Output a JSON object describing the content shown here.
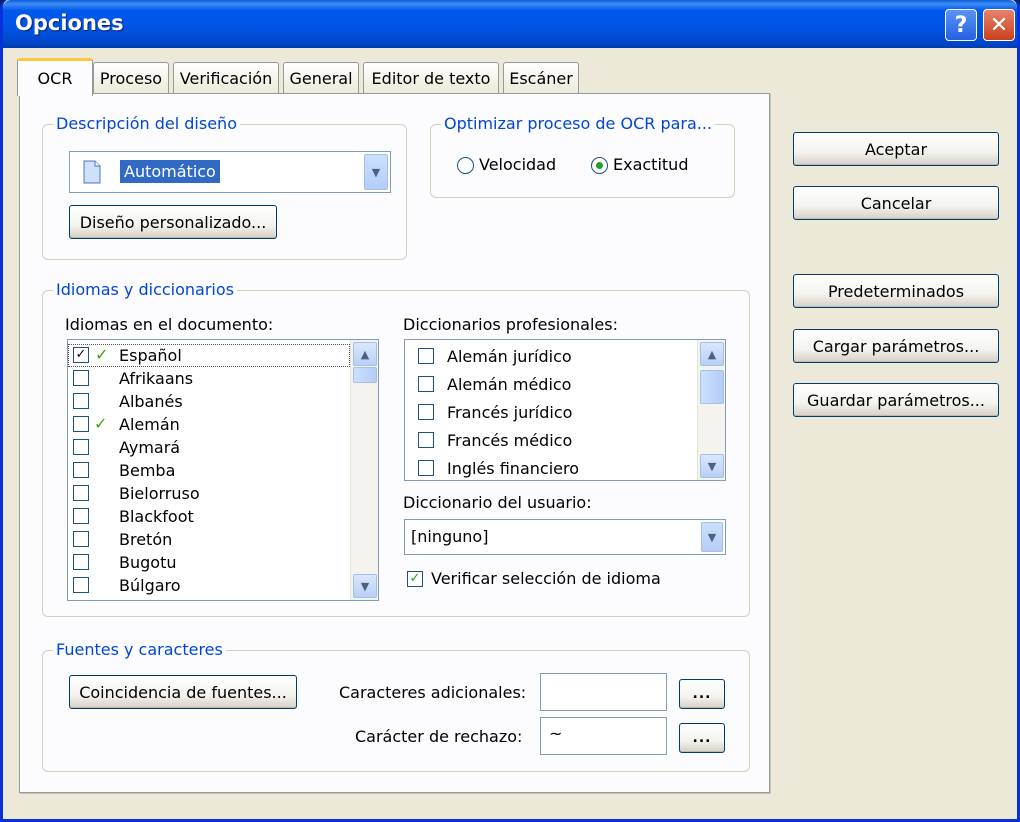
{
  "window": {
    "title": "Opciones",
    "help_glyph": "?",
    "close_glyph": "✕"
  },
  "tabs": [
    {
      "label": "OCR",
      "active": true
    },
    {
      "label": "Proceso"
    },
    {
      "label": "Verificación"
    },
    {
      "label": "General"
    },
    {
      "label": "Editor de texto"
    },
    {
      "label": "Escáner"
    }
  ],
  "layout_group": {
    "legend": "Descripción del diseño",
    "selected": "Automático",
    "custom_button": "Diseño personalizado..."
  },
  "optimize_group": {
    "legend": "Optimizar proceso de OCR para...",
    "options": [
      {
        "label": "Velocidad",
        "selected": false
      },
      {
        "label": "Exactitud",
        "selected": true
      }
    ]
  },
  "languages_group": {
    "legend": "Idiomas y diccionarios",
    "languages_label": "Idiomas en el documento:",
    "languages": [
      {
        "name": "Español",
        "checked": true,
        "has_dict": true
      },
      {
        "name": "Afrikaans",
        "checked": false,
        "has_dict": false
      },
      {
        "name": "Albanés",
        "checked": false,
        "has_dict": false
      },
      {
        "name": "Alemán",
        "checked": false,
        "has_dict": true
      },
      {
        "name": "Aymará",
        "checked": false,
        "has_dict": false
      },
      {
        "name": "Bemba",
        "checked": false,
        "has_dict": false
      },
      {
        "name": "Bielorruso",
        "checked": false,
        "has_dict": false
      },
      {
        "name": "Blackfoot",
        "checked": false,
        "has_dict": false
      },
      {
        "name": "Bretón",
        "checked": false,
        "has_dict": false
      },
      {
        "name": "Bugotu",
        "checked": false,
        "has_dict": false
      },
      {
        "name": "Búlgaro",
        "checked": false,
        "has_dict": false
      }
    ],
    "pro_dicts_label": "Diccionarios profesionales:",
    "pro_dicts": [
      {
        "name": "Alemán jurídico",
        "checked": false
      },
      {
        "name": "Alemán médico",
        "checked": false
      },
      {
        "name": "Francés jurídico",
        "checked": false
      },
      {
        "name": "Francés médico",
        "checked": false
      },
      {
        "name": "Inglés financiero",
        "checked": false
      }
    ],
    "user_dict_label": "Diccionario del usuario:",
    "user_dict_value": "[ninguno]",
    "verify_label": "Verificar selección de idioma",
    "verify_checked": true
  },
  "fonts_group": {
    "legend": "Fuentes y caracteres",
    "font_match_button": "Coincidencia de fuentes...",
    "extra_chars_label": "Caracteres adicionales:",
    "extra_chars_value": "",
    "reject_char_label": "Carácter de rechazo:",
    "reject_char_value": "~",
    "browse_label": "..."
  },
  "side_buttons": {
    "ok": "Aceptar",
    "cancel": "Cancelar",
    "defaults": "Predeterminados",
    "load": "Cargar parámetros...",
    "save": "Guardar parámetros..."
  },
  "colors": {
    "titlebar": "#0054e3",
    "dialog_bg": "#ece9d8",
    "group_legend": "#0046d5",
    "selection": "#316ac5",
    "check_green": "#21a121"
  }
}
